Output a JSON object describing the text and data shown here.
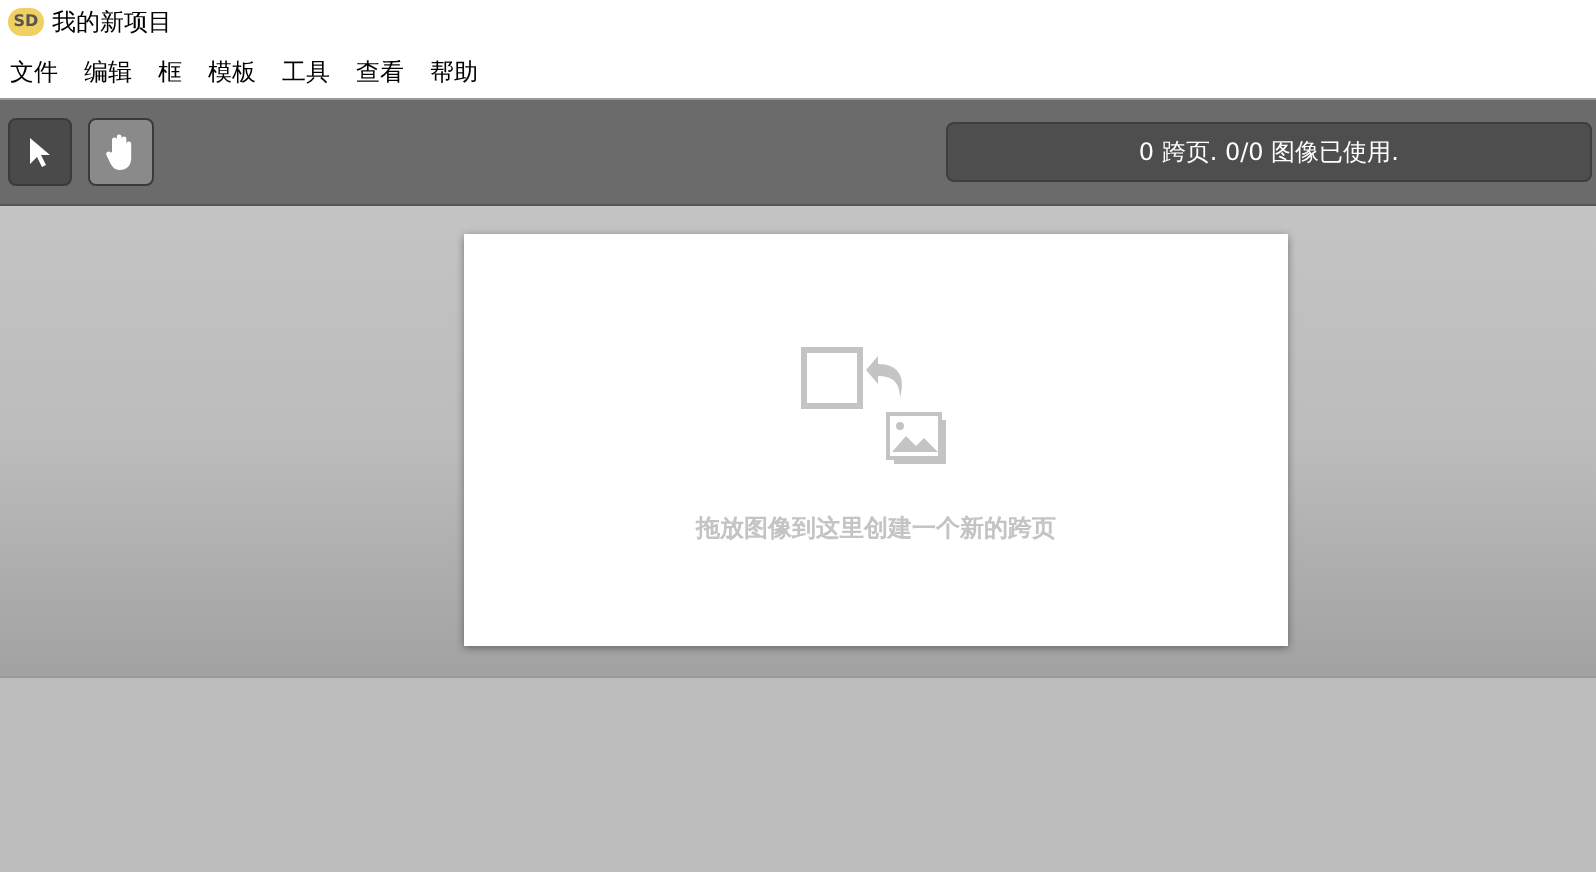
{
  "window": {
    "app_icon_text": "SD",
    "title": "我的新项目"
  },
  "menu": [
    "文件",
    "编辑",
    "框",
    "模板",
    "工具",
    "查看",
    "帮助"
  ],
  "tools": [
    {
      "kind": "pointer",
      "selected": true
    },
    {
      "kind": "hand",
      "selected": false
    }
  ],
  "status": "0 跨页. 0/0 图像已使用.",
  "drop_hint": "拖放图像到这里创建一个新的跨页"
}
